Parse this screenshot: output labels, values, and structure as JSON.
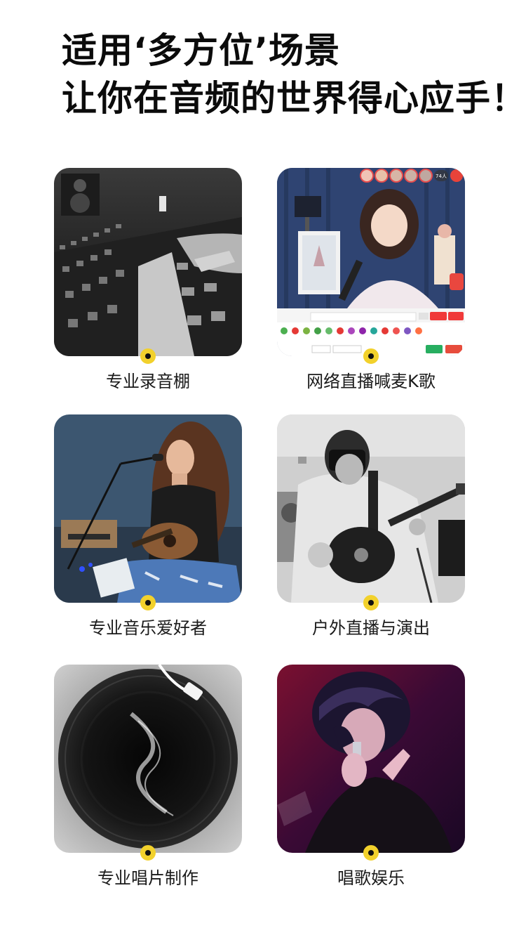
{
  "header": {
    "line1": "适用‘多方位’场景",
    "line2": "让你在音频的世界得心应手！"
  },
  "scenes": [
    {
      "label": "专业录音棚",
      "icon": "mixing-console-photo"
    },
    {
      "label": "网络直播喊麦K歌",
      "icon": "live-stream-photo",
      "overlay": {
        "viewers": "74人"
      }
    },
    {
      "label": "专业音乐爱好者",
      "icon": "guitarist-singing-photo"
    },
    {
      "label": "户外直播与演出",
      "icon": "electric-guitarist-photo"
    },
    {
      "label": "专业唱片制作",
      "icon": "vinyl-record-photo"
    },
    {
      "label": "唱歌娱乐",
      "icon": "singer-with-microphone-photo"
    }
  ],
  "colors": {
    "accent_dot": "#f2d12c",
    "text": "#111111"
  }
}
